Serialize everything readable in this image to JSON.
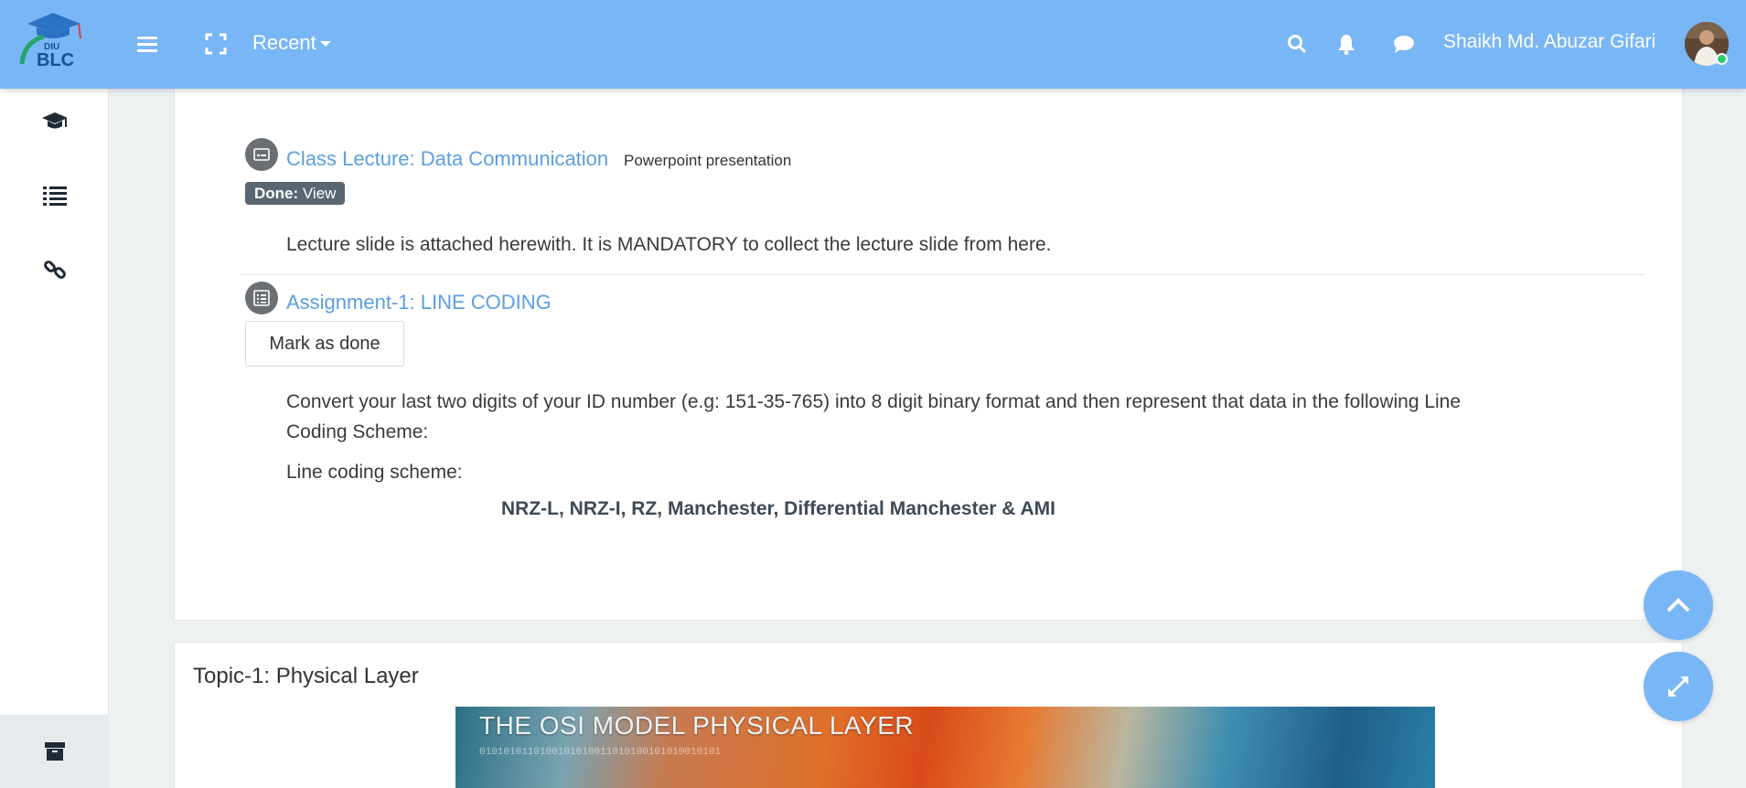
{
  "navbar": {
    "logo_text": "BLC",
    "logo_subtext": "DIU",
    "recent_label": "Recent",
    "user_name": "Shaikh Md. Abuzar Gifari",
    "icons": [
      "menu-icon",
      "fullscreen-icon",
      "search-icon",
      "bell-icon",
      "chat-icon"
    ]
  },
  "sidebar": {
    "items": [
      "graduation-cap-icon",
      "list-icon",
      "link-icon"
    ],
    "bottom_icon": "archive-icon"
  },
  "activities": [
    {
      "title": "Class Lecture: Data Communication",
      "type": "Powerpoint presentation",
      "badge_bold": "Done:",
      "badge_text": " View",
      "description": "Lecture slide is attached herewith. It is MANDATORY to collect the lecture slide from here."
    },
    {
      "title": "Assignment-1: LINE CODING",
      "button": "Mark as done",
      "description_line1": "Convert your last two digits of your ID number (e.g: 151-35-765) into 8 digit binary format and then represent that data in the following Line",
      "description_line2": "Coding Scheme:",
      "scheme_label": "Line coding scheme:",
      "schemes": "NRZ-L, NRZ-I, RZ, Manchester, Differential Manchester & AMI"
    }
  ],
  "topic": {
    "title": "Topic-1: Physical Layer",
    "banner_text": "THE OSI MODEL PHYSICAL LAYER",
    "banner_bits": "0101010110100101010011010100101010010101"
  },
  "colors": {
    "navbar": "#79b6f5",
    "link": "#5c9ee0",
    "badge": "#5a6670"
  }
}
